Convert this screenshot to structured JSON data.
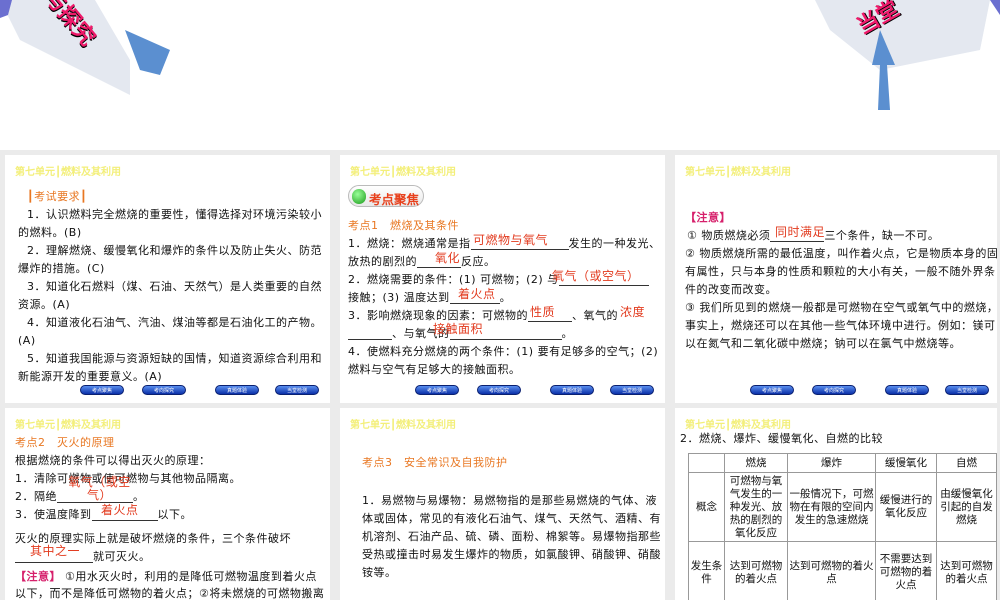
{
  "banner": {
    "left_text": "与探究",
    "right_text": "当堂"
  },
  "unit_header": "第七单元┃燃料及其利用",
  "nav": [
    "考点聚焦",
    "考向探究",
    "真题体验",
    "当堂检测"
  ],
  "slide1": {
    "heading": "┃考试要求┃",
    "lines": [
      "1．认识燃料完全燃烧的重要性，懂得选择对环境污染较小",
      "的燃料。(B)",
      "2．理解燃烧、缓慢氧化和爆炸的条件以及防止失火、防范",
      "爆炸的措施。(C)",
      "3．知道化石燃料（煤、石油、天然气）是人类重要的自然",
      "资源。(A)",
      "4．知道液化石油气、汽油、煤油等都是石油化工的产物。",
      "(A)",
      "5．知道我国能源与资源短缺的国情，知道资源综合利用和",
      "新能源开发的重要意义。(A)"
    ]
  },
  "slide2": {
    "badge": "考点聚焦",
    "title": "考点1　燃烧及其条件",
    "l1a": "1．燃烧：燃烧通常是指",
    "l1b": "发生的一种发光、",
    "l2a": "放热的剧烈的",
    "l2b": "反应。",
    "l3a": "2．燃烧需要的条件：(1) 可燃物；(2) 与",
    "l4a": "接触；(3) 温度达到",
    "l4b": "。",
    "l5a": "3．影响燃烧现象的因素：可燃物的",
    "l5b": "、氧气的",
    "l6a": "、与氧气的",
    "l6b": "。",
    "l7": "4．使燃料充分燃烧的两个条件：(1) 要有足够多的空气；(2)",
    "l8": "燃料与空气有足够大的接触面积。",
    "answers": [
      "可燃物与氧气",
      "氧化",
      "氧气（或空气）",
      "着火点",
      "性质",
      "浓度",
      "接触面积"
    ]
  },
  "slide3": {
    "note": "【注意】",
    "l1a": "① 物质燃烧必须",
    "l1b": "三个条件，缺一不可。",
    "answer": "同时满足",
    "lines": [
      "② 物质燃烧所需的最低温度，叫作着火点，它是物质本身的固",
      "有属性，只与本身的性质和颗粒的大小有关，一般不随外界条",
      "件的改变而改变。",
      "③ 我们所见到的燃烧一般都是可燃物在空气或氧气中的燃烧，",
      "事实上，燃烧还可以在其他一些气体环境中进行。例如：镁可",
      "以在氮气和二氧化碳中燃烧；钠可以在氯气中燃烧等。"
    ]
  },
  "slide4": {
    "title": "考点2　灭火的原理",
    "l1": "根据燃烧的条件可以得出灭火的原理：",
    "l2": "1．清除可燃物或使可燃物与其他物品隔离。",
    "l3a": "2．隔绝",
    "l3b": "。",
    "l4a": "3．使温度降到",
    "l4b": "以下。",
    "l5": "灭火的原理实际上就是破坏燃烧的条件，三个条件破坏",
    "l6b": "就可灭火。",
    "note": "【注意】",
    "l7": "①用水灭火时，利用的是降低可燃物温度到着火点",
    "l8": "以下，而不是降低可燃物的着火点；②将未燃烧的可燃物搬离",
    "answers": [
      "氧气（或空气）",
      "着火点",
      "其中之一"
    ]
  },
  "slide5": {
    "title": "考点3　安全常识及自我防护",
    "lines": [
      "1．易燃物与易爆物：易燃物指的是那些易燃烧的气体、液",
      "体或固体，常见的有液化石油气、煤气、天然气、酒精、有",
      "机溶剂、石油产品、硫、磷、面粉、棉絮等。易爆物指那些",
      "受热或撞击时易发生爆炸的物质，如氯酸钾、硝酸钾、硝酸",
      "铵等。"
    ]
  },
  "slide6": {
    "title": "2．燃烧、爆炸、缓慢氧化、自燃的比较",
    "headers": [
      "",
      "燃烧",
      "爆炸",
      "缓慢氧化",
      "自燃"
    ],
    "rows": [
      [
        "概念",
        "可燃物与氧气发生的一种发光、放热的剧烈的氧化反应",
        "一般情况下，可燃物在有限的空间内发生的急速燃烧",
        "缓慢进行的氧化反应",
        "由缓慢氧化引起的自发燃烧"
      ],
      [
        "发生条件",
        "达到可燃物的着火点",
        "达到可燃物的着火点",
        "不需要达到可燃物的着火点",
        "达到可燃物的着火点"
      ]
    ]
  }
}
